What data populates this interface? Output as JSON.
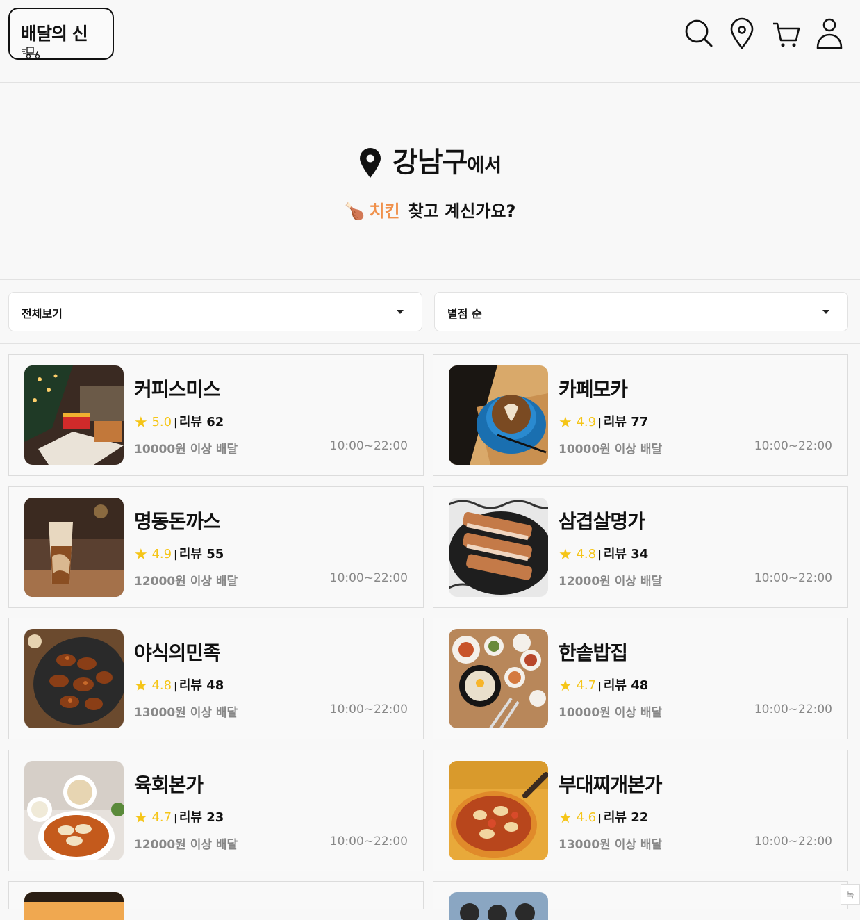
{
  "header": {
    "logo_text": "배달의 신",
    "icons": [
      "search-icon",
      "location-pin-icon",
      "cart-icon",
      "user-icon"
    ]
  },
  "hero": {
    "district": "강남구",
    "district_suffix": "에서",
    "emoji": "🍗",
    "keyword": "치킨",
    "question": "찾고 계신가요?"
  },
  "filters": {
    "category": "전체보기",
    "sort": "별점 순"
  },
  "stores": [
    {
      "name": "커피스미스",
      "rating": "5.0",
      "reviews": "리뷰 62",
      "min_order": "10000원 이상 배달",
      "hours": "10:00~22:00"
    },
    {
      "name": "카페모카",
      "rating": "4.9",
      "reviews": "리뷰 77",
      "min_order": "10000원 이상 배달",
      "hours": "10:00~22:00"
    },
    {
      "name": "명동돈까스",
      "rating": "4.9",
      "reviews": "리뷰 55",
      "min_order": "12000원 이상 배달",
      "hours": "10:00~22:00"
    },
    {
      "name": "삼겹살명가",
      "rating": "4.8",
      "reviews": "리뷰 34",
      "min_order": "12000원 이상 배달",
      "hours": "10:00~22:00"
    },
    {
      "name": "야식의민족",
      "rating": "4.8",
      "reviews": "리뷰 48",
      "min_order": "13000원 이상 배달",
      "hours": "10:00~22:00"
    },
    {
      "name": "한솥밥집",
      "rating": "4.7",
      "reviews": "리뷰 48",
      "min_order": "10000원 이상 배달",
      "hours": "10:00~22:00"
    },
    {
      "name": "육회본가",
      "rating": "4.7",
      "reviews": "리뷰 23",
      "min_order": "12000원 이상 배달",
      "hours": "10:00~22:00"
    },
    {
      "name": "부대찌개본가",
      "rating": "4.6",
      "reviews": "리뷰 22",
      "min_order": "13000원 이상 배달",
      "hours": "10:00~22:00"
    }
  ],
  "corner_badge": "녹"
}
